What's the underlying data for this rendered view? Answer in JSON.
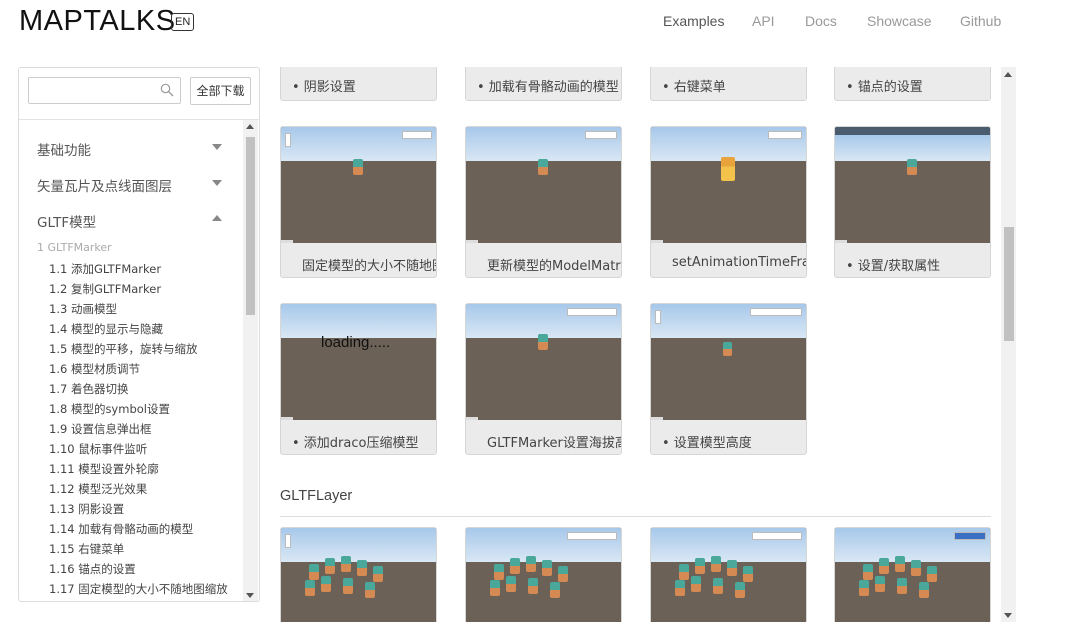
{
  "header": {
    "logo": "MAPTALKS",
    "lang": "EN",
    "nav": [
      "Examples",
      "API",
      "Docs",
      "Showcase",
      "Github"
    ]
  },
  "sidebar": {
    "search_placeholder": "",
    "download_label": "全部下载",
    "categories": [
      {
        "label": "基础功能",
        "state": "collapsed"
      },
      {
        "label": "矢量瓦片及点线面图层",
        "state": "collapsed"
      },
      {
        "label": "GLTF模型",
        "state": "expanded"
      }
    ],
    "sub_head": "1 GLTFMarker",
    "items": [
      "1.1 添加GLTFMarker",
      "1.2 复制GLTFMarker",
      "1.3 动画模型",
      "1.4 模型的显示与隐藏",
      "1.5 模型的平移，旋转与缩放",
      "1.6 模型材质调节",
      "1.7 着色器切换",
      "1.8 模型的symbol设置",
      "1.9 设置信息弹出框",
      "1.10 鼠标事件监听",
      "1.11 模型设置外轮廓",
      "1.12 模型泛光效果",
      "1.13 阴影设置",
      "1.14 加载有骨骼动画的模型",
      "1.15 右键菜单",
      "1.16 锚点的设置",
      "1.17 固定模型的大小不随地图缩放"
    ]
  },
  "cards_top": [
    "• 阴影设置",
    "• 加载有骨骼动画的模型",
    "• 右键菜单",
    "• 锚点的设置"
  ],
  "cards_row2": [
    "固定模型的大小不随地图缩放",
    "更新模型的ModelMatrix",
    "setAnimationTimeFrame",
    "• 设置/获取属性"
  ],
  "cards_row3": [
    "• 添加draco压缩模型",
    "GLTFMarker设置海拔高度",
    "• 设置模型高度"
  ],
  "loading_text": "loading.....",
  "section_title": "GLTFLayer",
  "colors": {
    "model_teal": "#4aa89a",
    "model_orange": "#d48a52",
    "ground": "#6b6157",
    "sky": "#a7c8ea"
  }
}
